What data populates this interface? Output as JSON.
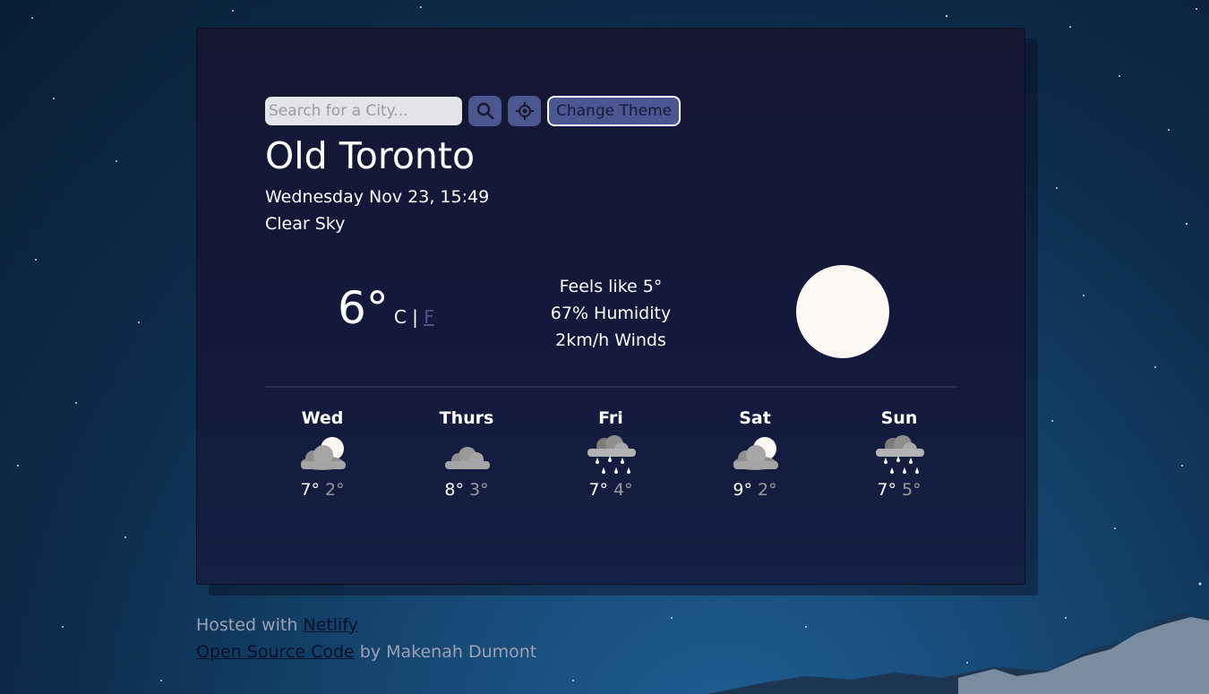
{
  "search": {
    "placeholder": "Search for a City..."
  },
  "buttons": {
    "search_icon": "search-icon",
    "locate_icon": "location-crosshair-icon",
    "theme_label": "Change Theme"
  },
  "weather": {
    "city": "Old Toronto",
    "datetime": "Wednesday Nov 23, 15:49",
    "description": "Clear Sky",
    "temperature": "6°",
    "unit_c": "C",
    "unit_sep": "|",
    "unit_f": "F",
    "feels_like": "Feels like 5°",
    "humidity": "67% Humidity",
    "wind": "2km/h Winds",
    "icon": "clear-day-sun-icon"
  },
  "forecast": [
    {
      "day": "Wed",
      "high": "7°",
      "low": "2°",
      "icon": "partly-cloudy-sun-icon"
    },
    {
      "day": "Thurs",
      "high": "8°",
      "low": "3°",
      "icon": "cloud-icon"
    },
    {
      "day": "Fri",
      "high": "7°",
      "low": "4°",
      "icon": "rain-cloud-icon"
    },
    {
      "day": "Sat",
      "high": "9°",
      "low": "2°",
      "icon": "partly-cloudy-sun-icon"
    },
    {
      "day": "Sun",
      "high": "7°",
      "low": "5°",
      "icon": "rain-cloud-icon"
    }
  ],
  "footer": {
    "hosted_prefix": "Hosted with",
    "netlify_link": "Netlify",
    "source_link": "Open Source Code",
    "author_suffix": "by Makenah Dumont"
  },
  "colors": {
    "accent": "#4c5690",
    "card": "#141632",
    "sun": "#fbf7f2",
    "low_temp": "#9a9a9a"
  }
}
